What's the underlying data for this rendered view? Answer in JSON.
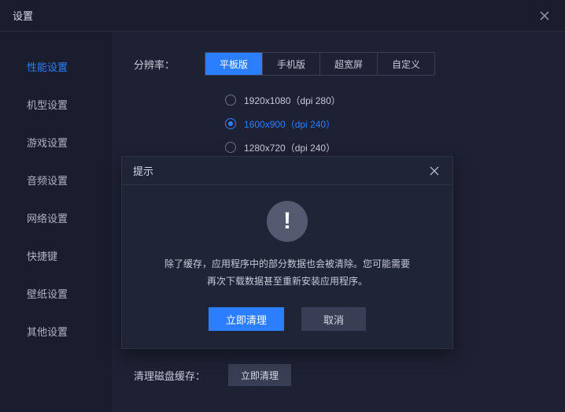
{
  "window": {
    "title": "设置"
  },
  "sidebar": {
    "items": [
      {
        "label": "性能设置",
        "active": true
      },
      {
        "label": "机型设置",
        "active": false
      },
      {
        "label": "游戏设置",
        "active": false
      },
      {
        "label": "音频设置",
        "active": false
      },
      {
        "label": "网络设置",
        "active": false
      },
      {
        "label": "快捷键",
        "active": false
      },
      {
        "label": "壁纸设置",
        "active": false
      },
      {
        "label": "其他设置",
        "active": false
      }
    ]
  },
  "resolution": {
    "label": "分辨率：",
    "tabs": [
      {
        "label": "平板版",
        "active": true
      },
      {
        "label": "手机版",
        "active": false
      },
      {
        "label": "超宽屏",
        "active": false
      },
      {
        "label": "自定义",
        "active": false
      }
    ],
    "options": [
      {
        "label": "1920x1080（dpi 280）",
        "selected": false
      },
      {
        "label": "1600x900（dpi 240）",
        "selected": true
      },
      {
        "label": "1280x720（dpi 240）",
        "selected": false
      }
    ]
  },
  "clear_cache": {
    "label": "清理磁盘缓存：",
    "button": "立即清理"
  },
  "modal": {
    "title": "提示",
    "message_line1": "除了缓存，应用程序中的部分数据也会被清除。您可能需要",
    "message_line2": "再次下载数据甚至重新安装应用程序。",
    "confirm": "立即清理",
    "cancel": "取消"
  }
}
